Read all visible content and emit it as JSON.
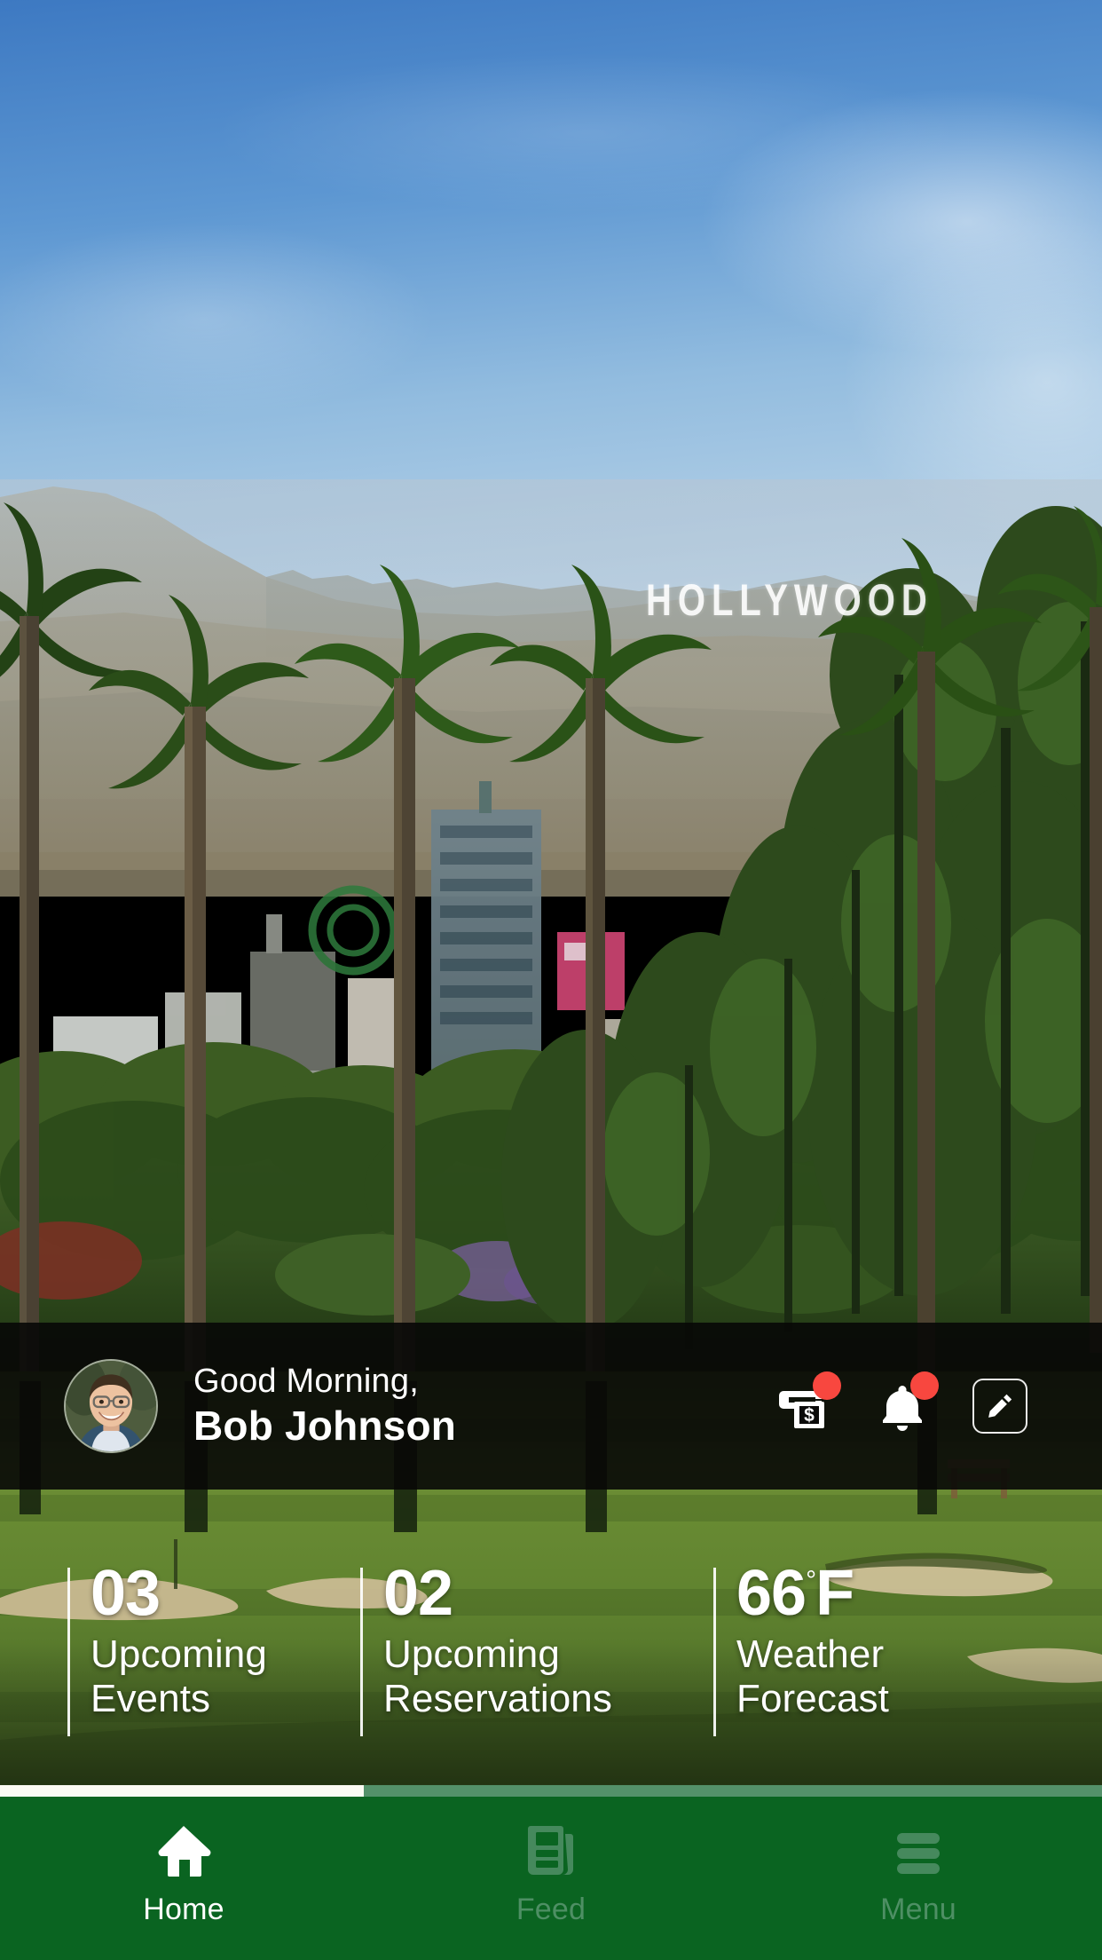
{
  "background": {
    "scene_name": "hollywood-hills-golf-course-photo",
    "landmark_text": "HOLLYWOOD",
    "sky_top_color": "#3f7cc4",
    "sky_bottom_color": "#bcd4e8",
    "hill_color": "#9a9a8a",
    "fairway_color": "#6d8a3c"
  },
  "greeting": {
    "salutation": "Good Morning,",
    "user_name": "Bob Johnson",
    "avatar_name": "user-profile-photo",
    "overlay_color": "#080807",
    "actions": [
      {
        "name": "billing-icon",
        "label": "Billing",
        "badge": true,
        "badge_color": "#f8473f"
      },
      {
        "name": "notifications-icon",
        "label": "Notifications",
        "badge": true,
        "badge_color": "#f8473f"
      },
      {
        "name": "compose-icon",
        "label": "Compose",
        "badge": false,
        "badge_color": ""
      }
    ]
  },
  "stats": [
    {
      "value": "03",
      "degree": "",
      "unit": "",
      "label_line1": "Upcoming",
      "label_line2": "Events"
    },
    {
      "value": "02",
      "degree": "",
      "unit": "",
      "label_line1": "Upcoming",
      "label_line2": "Reservations"
    },
    {
      "value": "66",
      "degree": "°",
      "unit": "F",
      "label_line1": "Weather",
      "label_line2": "Forecast"
    }
  ],
  "progress": {
    "percent": 33,
    "fill_color": "#fbfbf4",
    "track_color": "#54916a"
  },
  "bottom_nav": {
    "background_color": "#0a6421",
    "active_color": "#ffffff",
    "inactive_color": "#4e8f64",
    "items": [
      {
        "label": "Home",
        "icon": "home-icon",
        "active": true
      },
      {
        "label": "Feed",
        "icon": "newspaper-icon",
        "active": false
      },
      {
        "label": "Menu",
        "icon": "hamburger-icon",
        "active": false
      }
    ]
  }
}
